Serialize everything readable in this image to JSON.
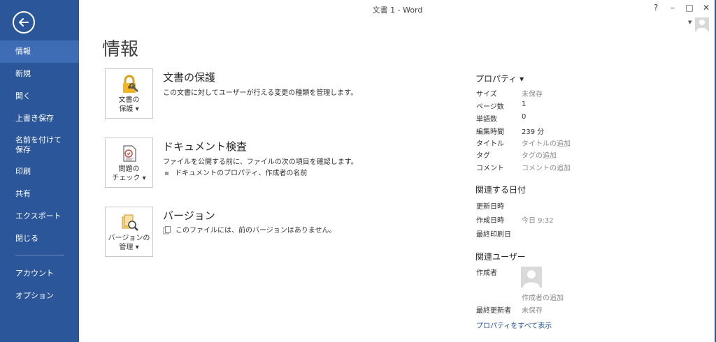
{
  "window": {
    "title": "文書 1 - Word",
    "help": "?",
    "minimize": "–",
    "maximize": "□",
    "close": "✕"
  },
  "sidebar": {
    "accent": "#2b579a",
    "items": [
      {
        "label": "情報",
        "active": true
      },
      {
        "label": "新規"
      },
      {
        "label": "開く"
      },
      {
        "label": "上書き保存"
      },
      {
        "label": "名前を付けて\n保存"
      },
      {
        "label": "印刷"
      },
      {
        "label": "共有"
      },
      {
        "label": "エクスポート"
      },
      {
        "label": "閉じる"
      },
      {
        "label": "アカウント"
      },
      {
        "label": "オプション"
      }
    ]
  },
  "main": {
    "title": "情報",
    "sections": [
      {
        "tile_line1": "文書の",
        "tile_line2": "保護 ▾",
        "icon": "lock-key-icon",
        "title": "文書の保護",
        "desc": "この文書に対してユーザーが行える変更の種類を管理します。"
      },
      {
        "tile_line1": "問題の",
        "tile_line2": "チェック ▾",
        "icon": "inspect-document-icon",
        "title": "ドキュメント検査",
        "desc": "ファイルを公開する前に、ファイルの次の項目を確認します。",
        "bullet": "ドキュメントのプロパティ、作成者の名前"
      },
      {
        "tile_line1": "バージョンの",
        "tile_line2": "管理 ▾",
        "icon": "manage-versions-icon",
        "title": "バージョン",
        "desc": "このファイルには、前のバージョンはありません。"
      }
    ]
  },
  "properties": {
    "heading": "プロパティ ▾",
    "rows": [
      {
        "label": "サイズ",
        "value": "未保存"
      },
      {
        "label": "ページ数",
        "value": "1"
      },
      {
        "label": "単語数",
        "value": "0"
      },
      {
        "label": "編集時間",
        "value": "239 分"
      },
      {
        "label": "タイトル",
        "value": "タイトルの追加"
      },
      {
        "label": "タグ",
        "value": "タグの追加"
      },
      {
        "label": "コメント",
        "value": "コメントの追加"
      }
    ],
    "dates_heading": "関連する日付",
    "dates": [
      {
        "label": "更新日時",
        "value": ""
      },
      {
        "label": "作成日時",
        "value": "今日 9:32"
      },
      {
        "label": "最終印刷日",
        "value": ""
      }
    ],
    "people_heading": "関連ユーザー",
    "author_label": "作成者",
    "add_author": "作成者の追加",
    "last_modified_label": "最終更新者",
    "last_modified_value": "未保存",
    "show_all": "プロパティをすべて表示"
  }
}
